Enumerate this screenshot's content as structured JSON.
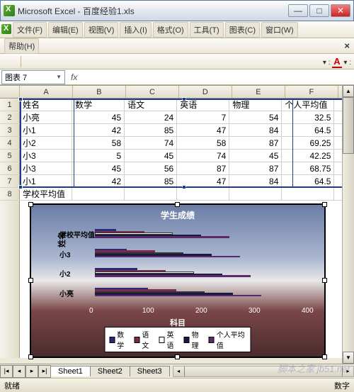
{
  "window": {
    "title": "Microsoft Excel - 百度经验1.xls"
  },
  "menu": {
    "file": "文件(F)",
    "edit": "编辑(E)",
    "view": "视图(V)",
    "insert": "插入(I)",
    "format": "格式(O)",
    "tools": "工具(T)",
    "chart": "图表(C)",
    "window": "窗口(W)",
    "help": "帮助(H)"
  },
  "namebox": {
    "value": "图表 7"
  },
  "columns": [
    "A",
    "B",
    "C",
    "D",
    "E",
    "F"
  ],
  "headers": {
    "A": "姓名",
    "B": "数学",
    "C": "语文",
    "D": "英语",
    "E": "物理",
    "F": "个人平均值"
  },
  "rows": [
    {
      "A": "小亮",
      "B": 45,
      "C": 24,
      "D": 7,
      "E": 54,
      "F": 32.5
    },
    {
      "A": "小1",
      "B": 42,
      "C": 85,
      "D": 47,
      "E": 84,
      "F": 64.5
    },
    {
      "A": "小2",
      "B": 58,
      "C": 74,
      "D": 58,
      "E": 87,
      "F": 69.25
    },
    {
      "A": "小3",
      "B": 5,
      "C": 45,
      "D": 74,
      "E": 45,
      "F": 42.25
    },
    {
      "A": "小3",
      "B": 45,
      "C": 56,
      "D": 87,
      "E": 87,
      "F": 68.75
    },
    {
      "A": "小1",
      "B": 42,
      "C": 85,
      "D": 47,
      "E": 84,
      "F": 64.5
    },
    {
      "A": "学校平均值",
      "B": "",
      "C": "",
      "D": "",
      "E": "",
      "F": ""
    }
  ],
  "chart_data": {
    "type": "bar",
    "title": "学生成绩",
    "xlabel": "科目",
    "ylabel": "姓名",
    "xlim": [
      0,
      400
    ],
    "xticks": [
      0,
      100,
      200,
      300,
      400
    ],
    "categories": [
      "学校平均值",
      "小3",
      "小2",
      "小亮"
    ],
    "series": [
      {
        "name": "数学",
        "color": "#2a2a7a"
      },
      {
        "name": "语文",
        "color": "#7a2a4a"
      },
      {
        "name": "英语",
        "color": "#ffffff"
      },
      {
        "name": "物理",
        "color": "#1a1a40"
      },
      {
        "name": "个人平均值",
        "color": "#5a2a6a"
      }
    ],
    "legend_position": "bottom"
  },
  "sheets": {
    "active": "Sheet1",
    "list": [
      "Sheet1",
      "Sheet2",
      "Sheet3"
    ]
  },
  "status": {
    "left": "就绪",
    "right": "数字"
  },
  "watermark": "脚本之家 jb51.net"
}
